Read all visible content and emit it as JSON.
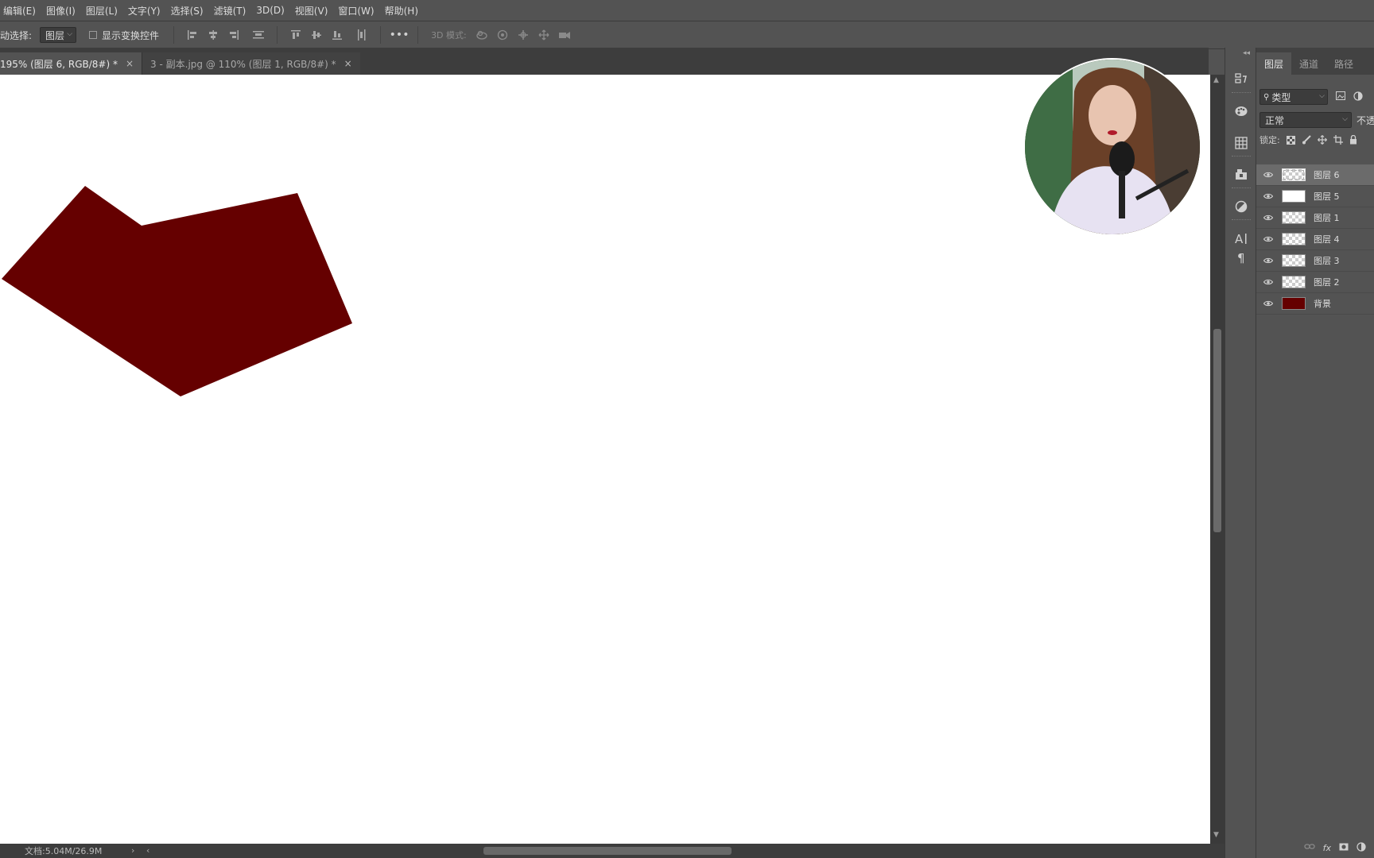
{
  "menu": [
    "编辑(E)",
    "图像(I)",
    "图层(L)",
    "文字(Y)",
    "选择(S)",
    "滤镜(T)",
    "3D(D)",
    "视图(V)",
    "窗口(W)",
    "帮助(H)"
  ],
  "options": {
    "auto_select_label": "自动选择:",
    "auto_select_value": "图层",
    "show_transform_label": "显示变换控件",
    "mode_3d_label": "3D 模式:"
  },
  "tabs": [
    {
      "label": "195% (图层 6, RGB/8#) *",
      "close": "×"
    },
    {
      "label": "3 - 副本.jpg @ 110% (图层 1, RGB/8#) *",
      "close": "×"
    }
  ],
  "status": {
    "doc": "文档:5.04M/26.9M",
    "chevron_right": "›",
    "chevron_left": "‹"
  },
  "panel": {
    "tabs": [
      "图层",
      "通道",
      "路径"
    ],
    "filter_value": "类型",
    "blend_value": "正常",
    "opacity_label": "不透",
    "lock_label": "锁定:"
  },
  "layers": [
    {
      "name": "图层 6",
      "thumb": "checker",
      "selected": true
    },
    {
      "name": "图层 5",
      "thumb": "white",
      "selected": false
    },
    {
      "name": "图层 1",
      "thumb": "checker",
      "selected": false
    },
    {
      "name": "图层 4",
      "thumb": "checker",
      "selected": false
    },
    {
      "name": "图层 3",
      "thumb": "checker",
      "selected": false
    },
    {
      "name": "图层 2",
      "thumb": "checker",
      "selected": false
    },
    {
      "name": "背景",
      "thumb": "red",
      "selected": false
    }
  ],
  "colors": {
    "shape_fill": "#650000",
    "ui_bg": "#535353",
    "canvas_bg": "#ffffff"
  },
  "icons": [
    "align-left-icon",
    "align-center-h-icon",
    "align-right-icon",
    "distribute-h-icon",
    "align-top-icon",
    "align-middle-v-icon",
    "align-bottom-icon",
    "distribute-v-icon",
    "more-icon",
    "3d-orbit-icon",
    "3d-roll-icon",
    "3d-pan-icon",
    "3d-slide-icon",
    "3d-camera-icon"
  ]
}
